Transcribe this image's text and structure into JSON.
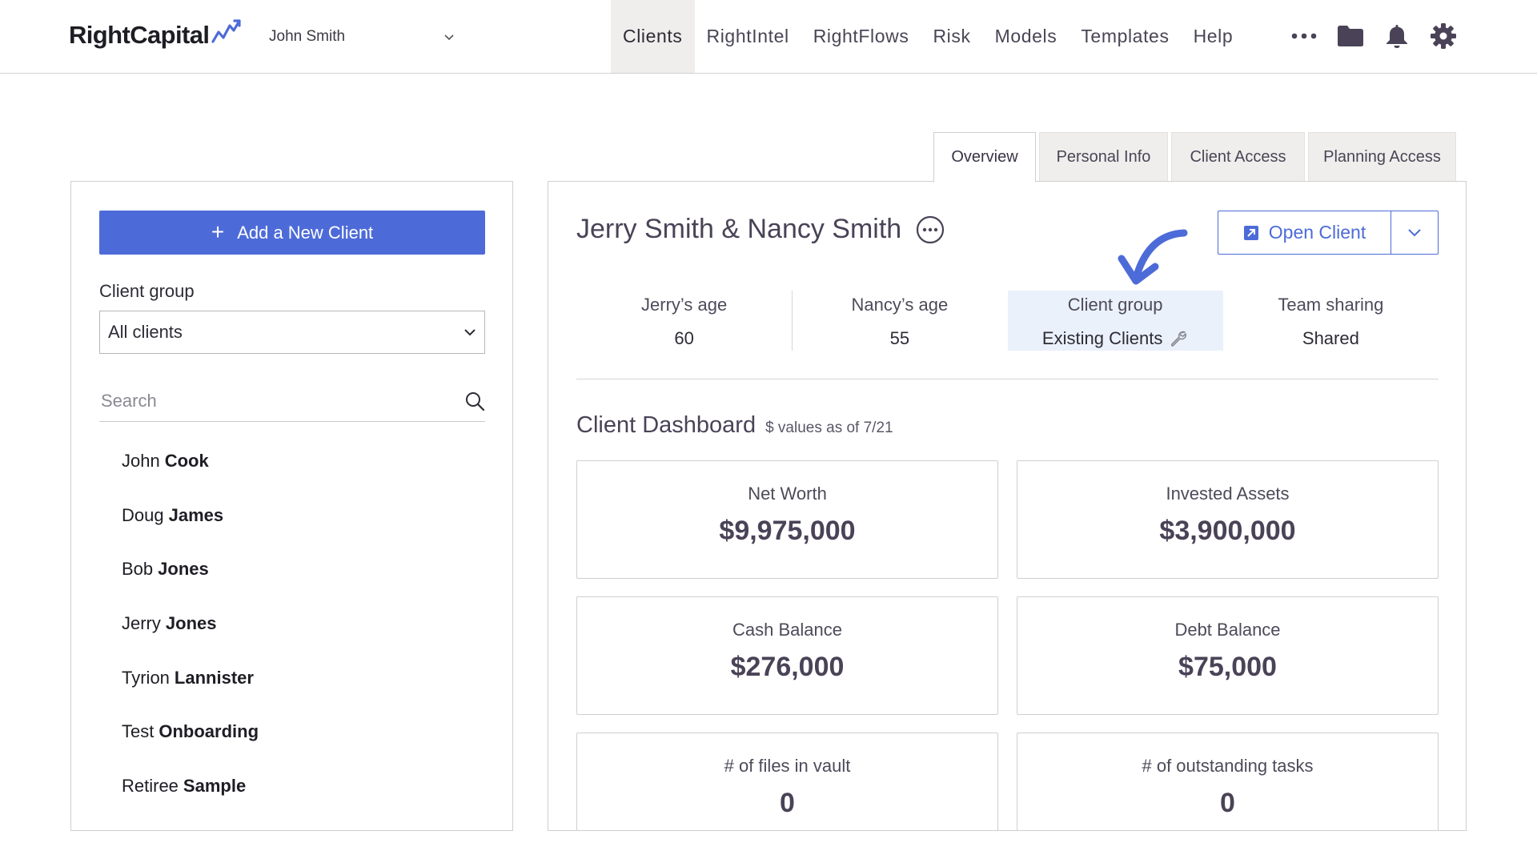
{
  "header": {
    "logo_text": "RightCapital",
    "advisor_name": "John Smith",
    "nav": [
      {
        "label": "Clients",
        "active": true
      },
      {
        "label": "RightIntel",
        "active": false
      },
      {
        "label": "RightFlows",
        "active": false
      },
      {
        "label": "Risk",
        "active": false
      },
      {
        "label": "Models",
        "active": false
      },
      {
        "label": "Templates",
        "active": false
      },
      {
        "label": "Help",
        "active": false
      }
    ],
    "icons": [
      "more-dots-icon",
      "folder-icon",
      "bell-icon",
      "gear-icon"
    ]
  },
  "sidebar": {
    "add_button_label": "Add a New Client",
    "client_group_label": "Client group",
    "client_group_value": "All clients",
    "search_placeholder": "Search",
    "clients": [
      {
        "first": "John",
        "last": "Cook"
      },
      {
        "first": "Doug",
        "last": "James"
      },
      {
        "first": "Bob",
        "last": "Jones"
      },
      {
        "first": "Jerry",
        "last": "Jones"
      },
      {
        "first": "Tyrion",
        "last": "Lannister"
      },
      {
        "first": "Test",
        "last": "Onboarding"
      },
      {
        "first": "Retiree",
        "last": "Sample"
      }
    ]
  },
  "tabs": [
    {
      "label": "Overview",
      "active": true
    },
    {
      "label": "Personal Info",
      "active": false
    },
    {
      "label": "Client Access",
      "active": false
    },
    {
      "label": "Planning Access",
      "active": false
    }
  ],
  "main": {
    "client_name": "Jerry Smith & Nancy Smith",
    "open_client_label": "Open Client",
    "stats": [
      {
        "label": "Jerry’s age",
        "value": "60"
      },
      {
        "label": "Nancy’s age",
        "value": "55"
      },
      {
        "label": "Client group",
        "value": "Existing Clients"
      },
      {
        "label": "Team sharing",
        "value": "Shared"
      }
    ],
    "dashboard_title": "Client Dashboard",
    "dashboard_subtitle": "$ values as of 7/21",
    "cards": [
      {
        "label": "Net Worth",
        "value": "$9,975,000"
      },
      {
        "label": "Invested Assets",
        "value": "$3,900,000"
      },
      {
        "label": "Cash Balance",
        "value": "$276,000"
      },
      {
        "label": "Debt Balance",
        "value": "$75,000"
      },
      {
        "label": "# of files in vault",
        "value": "0"
      },
      {
        "label": "# of outstanding tasks",
        "value": "0"
      }
    ]
  },
  "colors": {
    "accent": "#4d6bd8",
    "highlight": "#eaf1fb",
    "active_nav_bg": "#efeeec"
  }
}
